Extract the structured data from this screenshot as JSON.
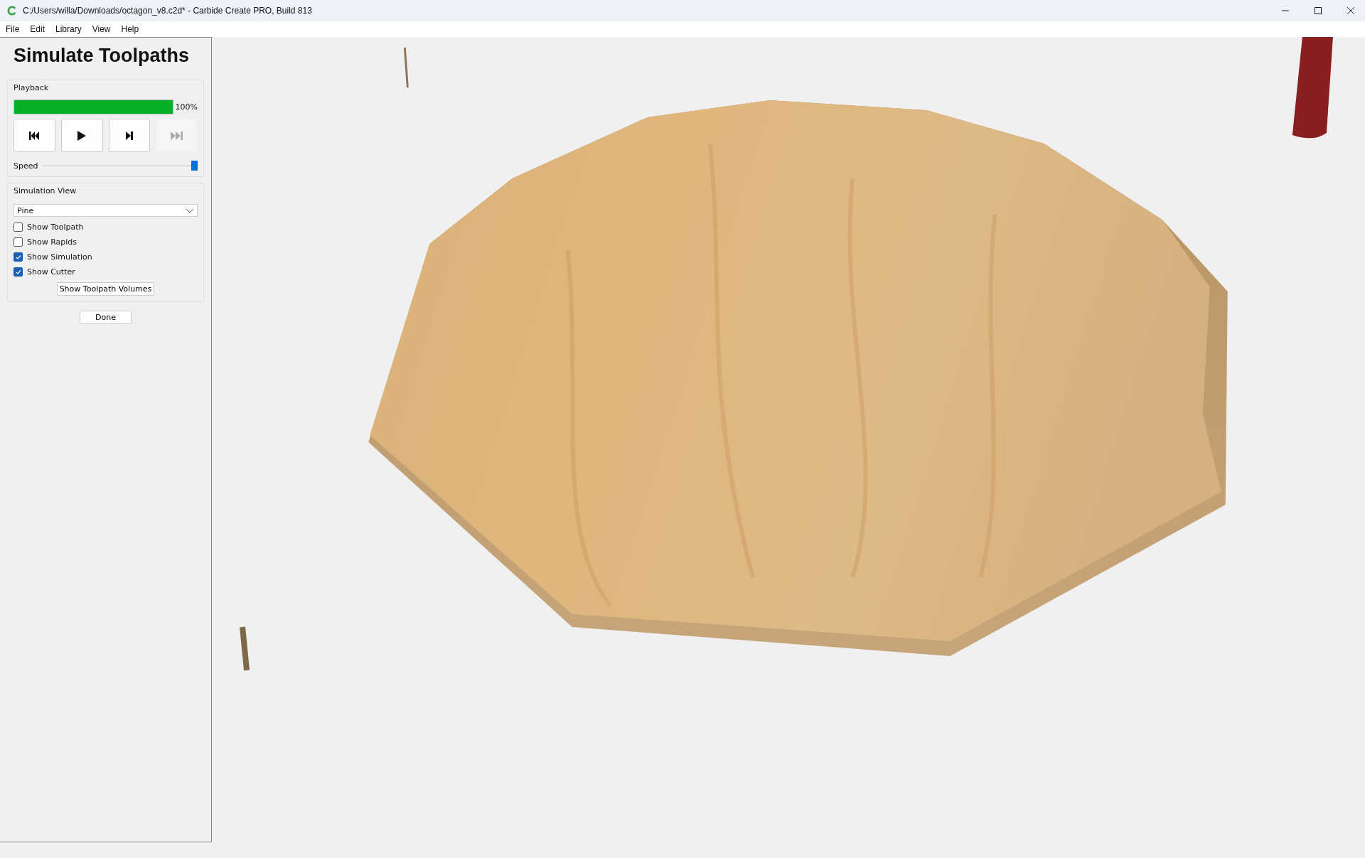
{
  "window": {
    "title": "C:/Users/willa/Downloads/octagon_v8.c2d* - Carbide Create PRO, Build 813"
  },
  "menu": [
    "File",
    "Edit",
    "Library",
    "View",
    "Help"
  ],
  "panel": {
    "heading": "Simulate Toolpaths",
    "playback": {
      "label": "Playback",
      "progress": {
        "level": 1.0,
        "reading": "100%"
      },
      "controls": [
        {
          "kind": "start",
          "disabled": false
        },
        {
          "kind": "play",
          "disabled": false
        },
        {
          "kind": "step",
          "disabled": false
        },
        {
          "kind": "end",
          "disabled": true
        }
      ],
      "speed": {
        "label": "Speed",
        "level": 1.0
      }
    },
    "simulation_view": {
      "label": "Simulation View",
      "material": "Pine",
      "options": [
        {
          "label": "Show Toolpath",
          "checked": false
        },
        {
          "label": "Show Rapids",
          "checked": false
        },
        {
          "label": "Show Simulation",
          "checked": true
        },
        {
          "label": "Show Cutter",
          "checked": true
        }
      ],
      "button": "Show Toolpath Volumes"
    },
    "done": "Done"
  }
}
